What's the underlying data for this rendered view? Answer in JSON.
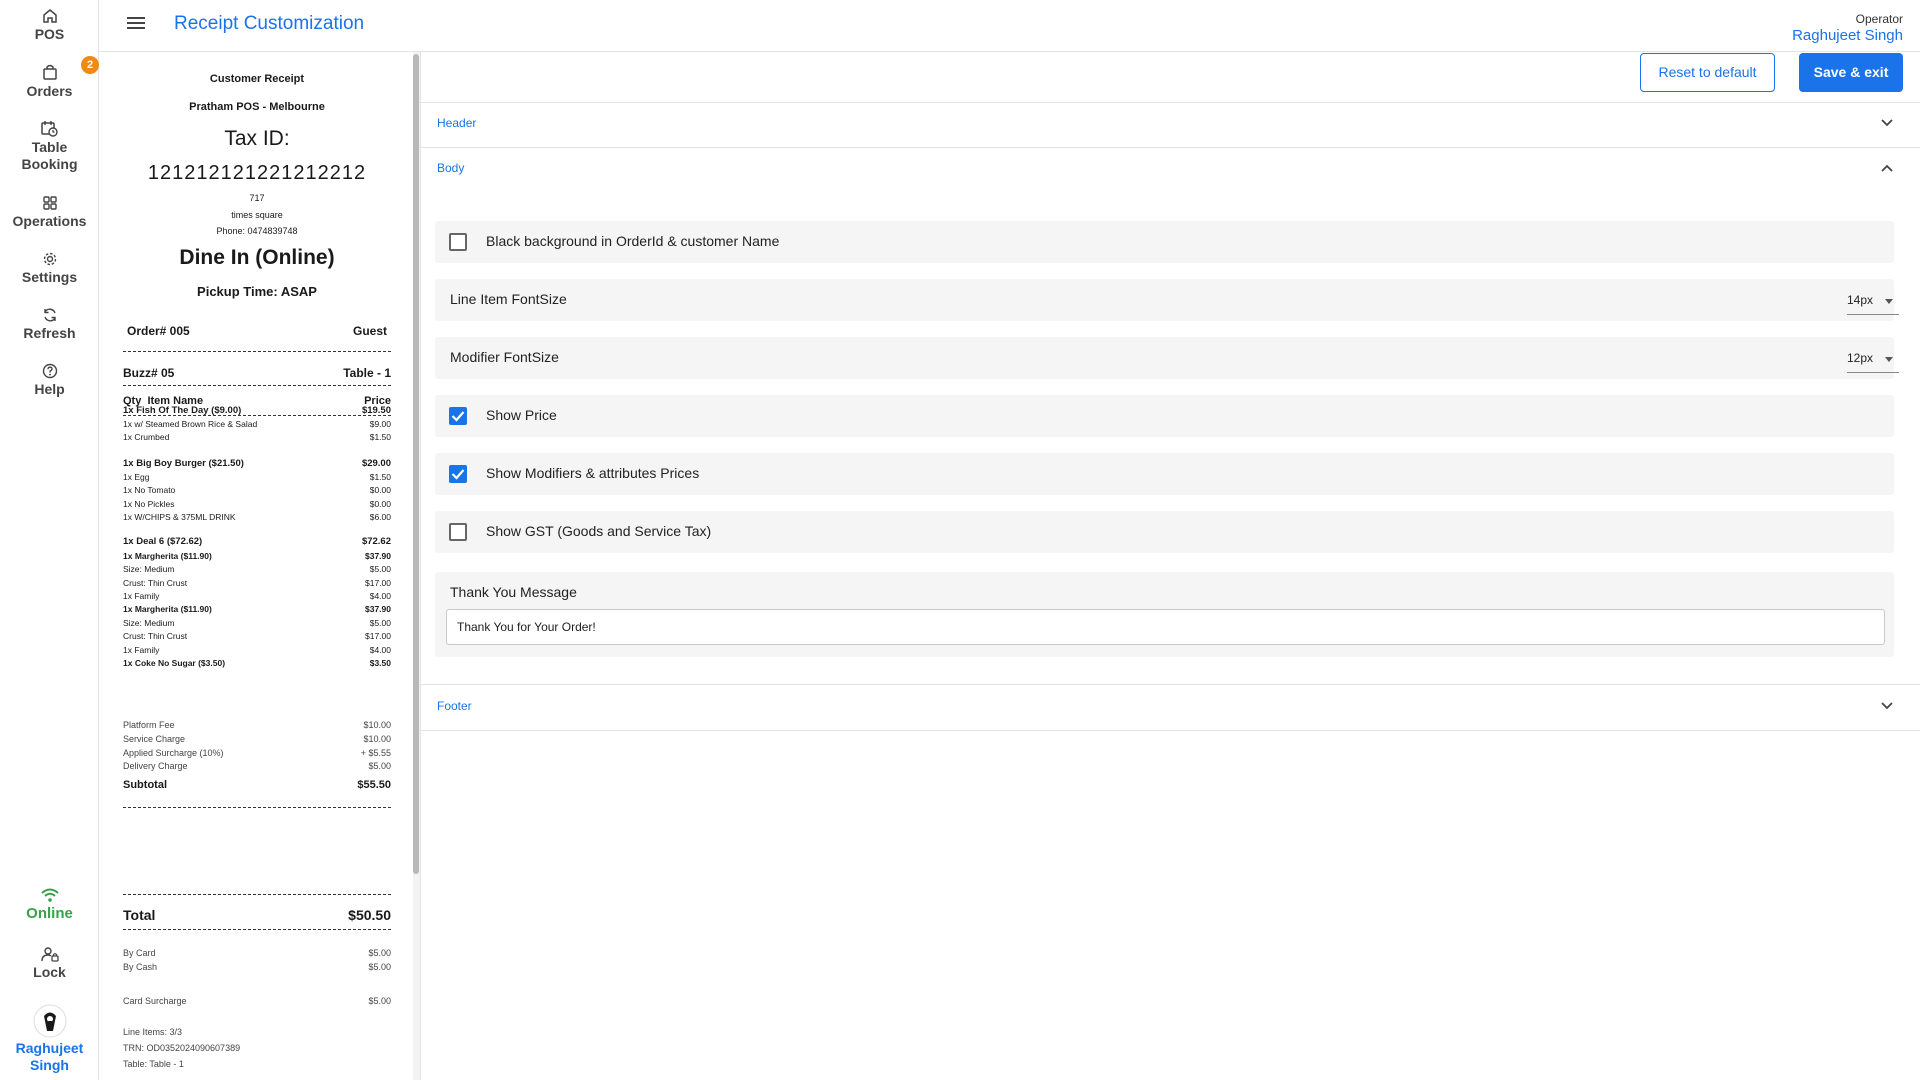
{
  "app": {
    "page_title": "Receipt Customization",
    "operator_role": "Operator",
    "operator_name": "Raghujeet Singh"
  },
  "nav": {
    "items": [
      {
        "label": "POS",
        "icon": "home-icon"
      },
      {
        "label": "Orders",
        "icon": "bag-icon",
        "badge": "2"
      },
      {
        "label": "Table Booking",
        "icon": "calendar-clock-icon"
      },
      {
        "label": "Operations",
        "icon": "grid-icon"
      },
      {
        "label": "Settings",
        "icon": "gear-icon"
      },
      {
        "label": "Refresh",
        "icon": "refresh-icon"
      },
      {
        "label": "Help",
        "icon": "help-icon"
      }
    ],
    "status": "Online",
    "lock": "Lock",
    "user_name": "Raghujeet Singh"
  },
  "receipt": {
    "title": "Customer Receipt",
    "store": "Pratham POS - Melbourne",
    "tax_id_label": "Tax ID:",
    "tax_id": "121212121221212212",
    "addr1": "717",
    "addr2": "times square",
    "phone": "Phone: 0474839748",
    "order_type": "Dine In (Online)",
    "pickup": "Pickup Time: ASAP",
    "order_no": "Order# 005",
    "customer": "Guest",
    "buzz": "Buzz# 05",
    "table": "Table - 1",
    "col_qty_item": "Qty  Item Name",
    "col_price": "Price",
    "lines": [
      {
        "name": "1x Fish Of The Day ($9.00)",
        "price": "$19.50",
        "bold": true
      },
      {
        "name": "1x w/ Steamed Brown Rice & Salad",
        "price": "$9.00"
      },
      {
        "name": "1x Crumbed",
        "price": "$1.50"
      },
      {
        "name": "1x Big Boy Burger ($21.50)",
        "price": "$29.00",
        "bold": true
      },
      {
        "name": "1x Egg",
        "price": "$1.50"
      },
      {
        "name": "1x No Tomato",
        "price": "$0.00"
      },
      {
        "name": "1x No Pickles",
        "price": "$0.00"
      },
      {
        "name": "1x W/CHIPS & 375ML DRINK",
        "price": "$6.00"
      },
      {
        "name": "1x Deal 6 ($72.62)",
        "price": "$72.62",
        "bold": true
      },
      {
        "name": "1x Margherita ($11.90)",
        "price": "$37.90",
        "semibold": true
      },
      {
        "name": "Size: Medium",
        "price": "$5.00"
      },
      {
        "name": "Crust: Thin Crust",
        "price": "$17.00"
      },
      {
        "name": "1x Family",
        "price": "$4.00"
      },
      {
        "name": "1x Margherita ($11.90)",
        "price": "$37.90",
        "semibold": true
      },
      {
        "name": "Size: Medium",
        "price": "$5.00"
      },
      {
        "name": "Crust: Thin Crust",
        "price": "$17.00"
      },
      {
        "name": "1x Family",
        "price": "$4.00"
      },
      {
        "name": "1x Coke No Sugar ($3.50)",
        "price": "$3.50",
        "semibold": true
      }
    ],
    "subtotal_label": "Subtotal",
    "subtotal": "$55.50",
    "charges": [
      {
        "name": "Platform Fee",
        "price": "$10.00"
      },
      {
        "name": "Service Charge",
        "price": "$10.00"
      },
      {
        "name": "Applied Surcharge (10%)",
        "price": "+ $5.55"
      },
      {
        "name": "Delivery Charge",
        "price": "$5.00"
      }
    ],
    "total_label": "Total",
    "total": "$50.50",
    "payments": [
      {
        "name": "By Card",
        "price": "$5.00"
      },
      {
        "name": "By Cash",
        "price": "$5.00"
      }
    ],
    "card_surcharge_label": "Card Surcharge",
    "card_surcharge": "$5.00",
    "line_items": "Line Items: 3/3",
    "trn": "TRN: OD0352024090607389",
    "table_info": "Table: Table - 1"
  },
  "settings": {
    "reset_label": "Reset to default",
    "save_label": "Save & exit",
    "sections": {
      "header": "Header",
      "body": "Body",
      "footer": "Footer"
    },
    "options": {
      "black_bg": {
        "label": "Black background in OrderId & customer Name",
        "checked": false
      },
      "line_item_font": {
        "label": "Line Item FontSize",
        "value": "14px"
      },
      "modifier_font": {
        "label": "Modifier FontSize",
        "value": "12px"
      },
      "show_price": {
        "label": "Show Price",
        "checked": true
      },
      "show_modifier_prices": {
        "label": "Show Modifiers & attributes Prices",
        "checked": true
      },
      "show_gst": {
        "label": "Show GST (Goods and Service Tax)",
        "checked": false
      }
    },
    "thank_you_label": "Thank You Message",
    "thank_you_value": "Thank You for Your Order!"
  },
  "colors": {
    "accent": "#1a73e8",
    "online": "#36a34a",
    "badge": "#f08a12"
  }
}
